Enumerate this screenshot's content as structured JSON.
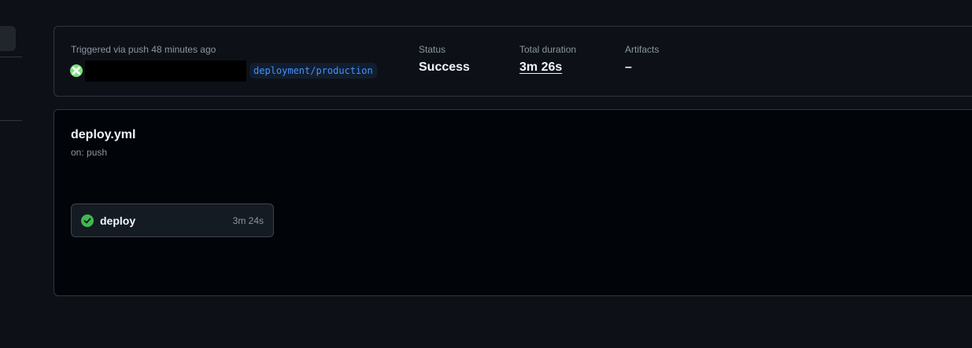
{
  "summary": {
    "trigger_text": "Triggered via push 48 minutes ago",
    "branch": "deployment/production",
    "status_label": "Status",
    "status_value": "Success",
    "duration_label": "Total duration",
    "duration_value": "3m 26s",
    "artifacts_label": "Artifacts",
    "artifacts_value": "–"
  },
  "workflow": {
    "file_name": "deploy.yml",
    "trigger": "on: push",
    "jobs": [
      {
        "name": "deploy",
        "duration": "3m 24s",
        "status": "success"
      }
    ]
  },
  "colors": {
    "background": "#0d1117",
    "success": "#3fb950",
    "branch_text": "#4493f8",
    "border": "#30363d"
  }
}
